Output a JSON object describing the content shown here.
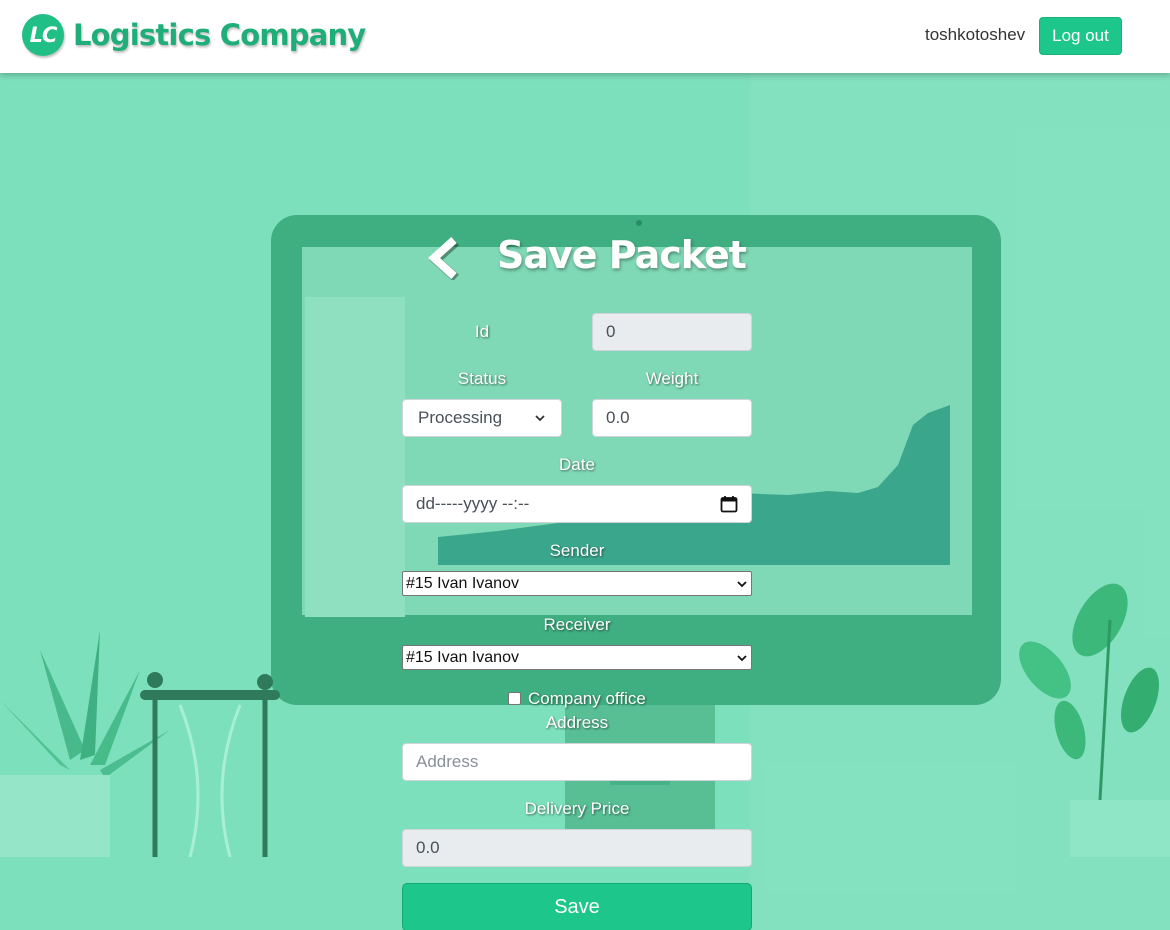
{
  "header": {
    "logo_initials": "LC",
    "logo_text": "Logistics Company",
    "username": "toshkotoshev",
    "logout_label": "Log out"
  },
  "page": {
    "title": "Save Packet",
    "back_icon": "chevron-left-icon"
  },
  "form": {
    "id_label": "Id",
    "id_value": "0",
    "status_label": "Status",
    "status_selected": "Processing",
    "weight_label": "Weight",
    "weight_value": "0.0",
    "date_label": "Date",
    "date_placeholder": "dd-----yyyy --:--",
    "sender_label": "Sender",
    "sender_selected": "#15 Ivan Ivanov",
    "receiver_label": "Receiver",
    "receiver_selected": "#15 Ivan Ivanov",
    "company_office_label": "Company office",
    "company_office_checked": false,
    "address_label": "Address",
    "address_placeholder": "Address",
    "delivery_price_label": "Delivery Price",
    "delivery_price_value": "0.0",
    "save_label": "Save"
  },
  "colors": {
    "brand": "#1dc78b",
    "background_overlay": "#7de0bd",
    "header_bg": "#ffffff"
  }
}
